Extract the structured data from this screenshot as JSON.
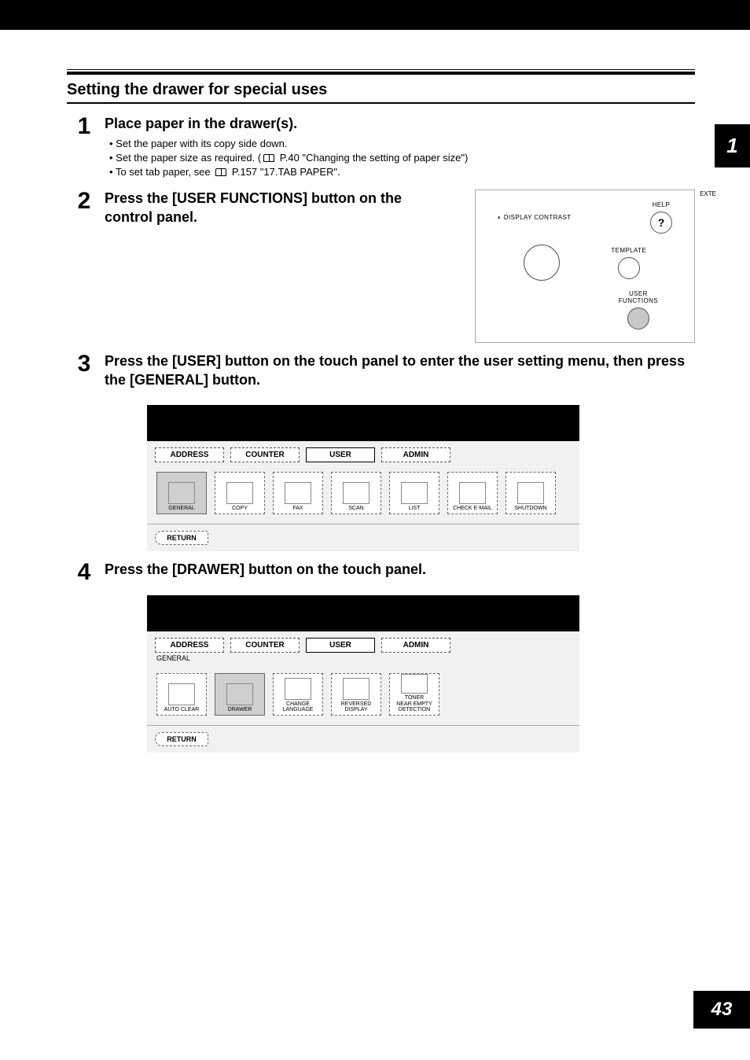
{
  "chapter": "1",
  "page_number": "43",
  "section_title": "Setting the drawer for special uses",
  "step1": {
    "heading": "Place paper in the drawer(s).",
    "b1": "Set the paper with its copy side down.",
    "b2_pre": "Set the paper size as required. (",
    "b2_ref": " P.40 \"Changing the setting of paper size\")",
    "b3_pre": "To set tab paper, see ",
    "b3_ref": " P.157 \"17.TAB PAPER\"."
  },
  "step2": {
    "heading": "Press the [USER FUNCTIONS] button on the control panel.",
    "exte": "EXTE",
    "display_contrast": "DISPLAY CONTRAST",
    "help": "HELP",
    "template": "TEMPLATE",
    "user_functions": "USER\nFUNCTIONS"
  },
  "step3": {
    "heading": "Press the [USER] button on the touch panel to enter the user setting menu, then press the [GENERAL] button.",
    "tabs": {
      "address": "ADDRESS",
      "counter": "COUNTER",
      "user": "USER",
      "admin": "ADMIN"
    },
    "tiles": {
      "general": "GENERAL",
      "copy": "COPY",
      "fax": "FAX",
      "scan": "SCAN",
      "list": "LIST",
      "check_email": "CHECK E-MAIL",
      "shutdown": "SHUTDOWN"
    },
    "return": "RETURN"
  },
  "step4": {
    "heading": "Press the [DRAWER] button on the touch panel.",
    "tabs": {
      "address": "ADDRESS",
      "counter": "COUNTER",
      "user": "USER",
      "admin": "ADMIN"
    },
    "sublabel": "GENERAL",
    "tiles": {
      "auto_clear": "AUTO CLEAR",
      "drawer": "DRAWER",
      "change_language": "CHANGE\nLANGUAGE",
      "reversed_display": "REVERSED\nDISPLAY",
      "toner_detect": "TONER\nNEAR EMPTY\nDETECTION"
    },
    "return": "RETURN"
  }
}
